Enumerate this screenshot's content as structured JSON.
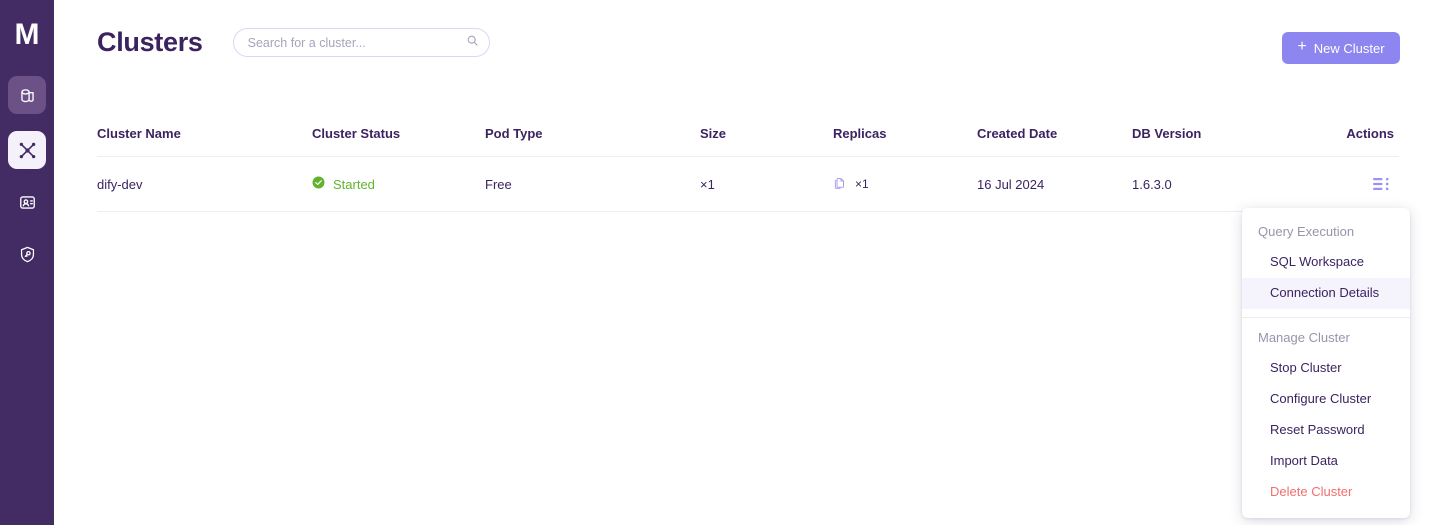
{
  "sidebar": {
    "logo": "M",
    "items": [
      {
        "name": "database-icon",
        "label": "Databases",
        "state": "dim"
      },
      {
        "name": "cluster-nodes-icon",
        "label": "Clusters",
        "state": "active"
      },
      {
        "name": "id-card-icon",
        "label": "Accounts",
        "state": "plain"
      },
      {
        "name": "shield-key-icon",
        "label": "Security",
        "state": "plain"
      }
    ]
  },
  "header": {
    "title": "Clusters",
    "search": {
      "placeholder": "Search for a cluster...",
      "value": "",
      "icon": "search-icon"
    },
    "new_cluster_label": "New Cluster",
    "new_cluster_icon": "plus-icon",
    "accent_color": "#8d85f0"
  },
  "table": {
    "columns": [
      "Cluster Name",
      "Cluster Status",
      "Pod Type",
      "Size",
      "Replicas",
      "Created Date",
      "DB Version",
      "Actions"
    ],
    "rows": [
      {
        "cluster_name": "dify-dev",
        "status": "Started",
        "status_color": "#62b22e",
        "status_icon": "check-circle-icon",
        "pod_type": "Free",
        "size": "×1",
        "replicas": "×1",
        "replicas_icon": "copies-icon",
        "created_date": "16 Jul 2024",
        "db_version": "1.6.3.0",
        "actions_icon": "list-menu-icon"
      }
    ]
  },
  "menu": {
    "sections": [
      {
        "label": "Query Execution",
        "items": [
          {
            "label": "SQL Workspace",
            "highlighted": false,
            "danger": false
          },
          {
            "label": "Connection Details",
            "highlighted": true,
            "danger": false
          }
        ]
      },
      {
        "label": "Manage Cluster",
        "items": [
          {
            "label": "Stop Cluster",
            "highlighted": false,
            "danger": false
          },
          {
            "label": "Configure Cluster",
            "highlighted": false,
            "danger": false
          },
          {
            "label": "Reset Password",
            "highlighted": false,
            "danger": false
          },
          {
            "label": "Import Data",
            "highlighted": false,
            "danger": false
          },
          {
            "label": "Delete Cluster",
            "highlighted": false,
            "danger": true
          }
        ]
      }
    ],
    "danger_color": "#f0706e"
  }
}
